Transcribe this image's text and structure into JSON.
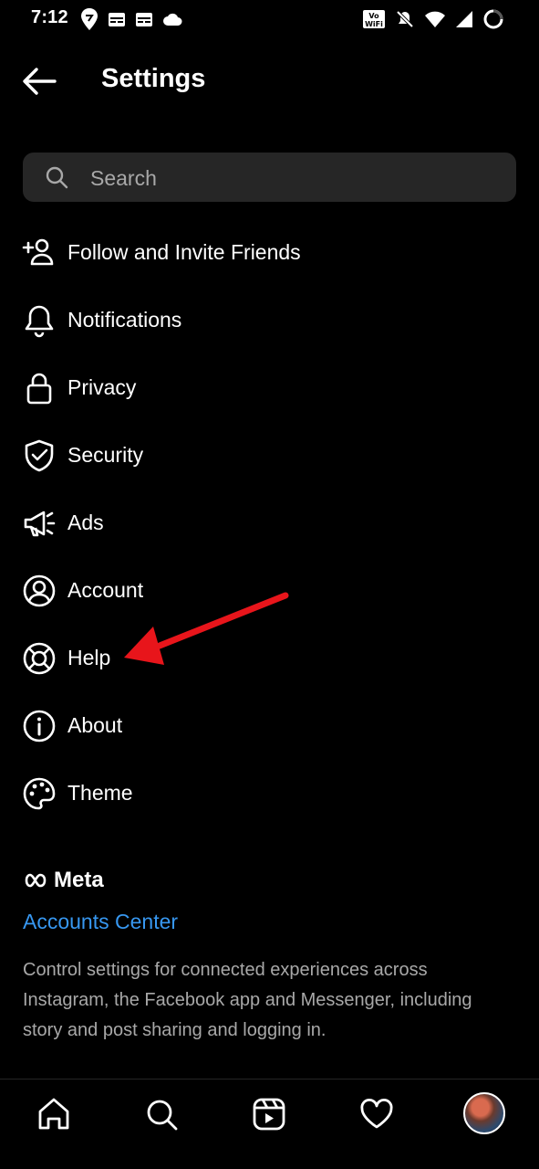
{
  "status_bar": {
    "time": "7:12",
    "left_icons": [
      "swiggy-icon",
      "calendar-icon",
      "calendar-icon",
      "cloud-icon"
    ],
    "right_icons": [
      "vowifi-icon",
      "mute-icon",
      "wifi-icon",
      "signal-icon",
      "battery-icon"
    ]
  },
  "header": {
    "title": "Settings"
  },
  "search": {
    "placeholder": "Search"
  },
  "menu": {
    "items": [
      {
        "label": "Follow and Invite Friends",
        "icon": "add-person-icon"
      },
      {
        "label": "Notifications",
        "icon": "bell-icon"
      },
      {
        "label": "Privacy",
        "icon": "lock-icon"
      },
      {
        "label": "Security",
        "icon": "shield-check-icon"
      },
      {
        "label": "Ads",
        "icon": "megaphone-icon"
      },
      {
        "label": "Account",
        "icon": "account-circle-icon"
      },
      {
        "label": "Help",
        "icon": "lifebuoy-icon"
      },
      {
        "label": "About",
        "icon": "info-icon"
      },
      {
        "label": "Theme",
        "icon": "palette-icon"
      }
    ]
  },
  "meta": {
    "logo_text": "Meta",
    "accounts_center": "Accounts Center",
    "description": "Control settings for connected experiences across Instagram, the Facebook app and Messenger, including story and post sharing and logging in."
  },
  "tab_bar": {
    "tabs": [
      "home-icon",
      "search-icon",
      "reels-icon",
      "heart-icon",
      "profile-avatar"
    ]
  },
  "colors": {
    "background": "#000000",
    "link": "#3797f0",
    "muted": "#a8a8a8",
    "search_bg": "#262626",
    "arrow": "#e8151b"
  }
}
